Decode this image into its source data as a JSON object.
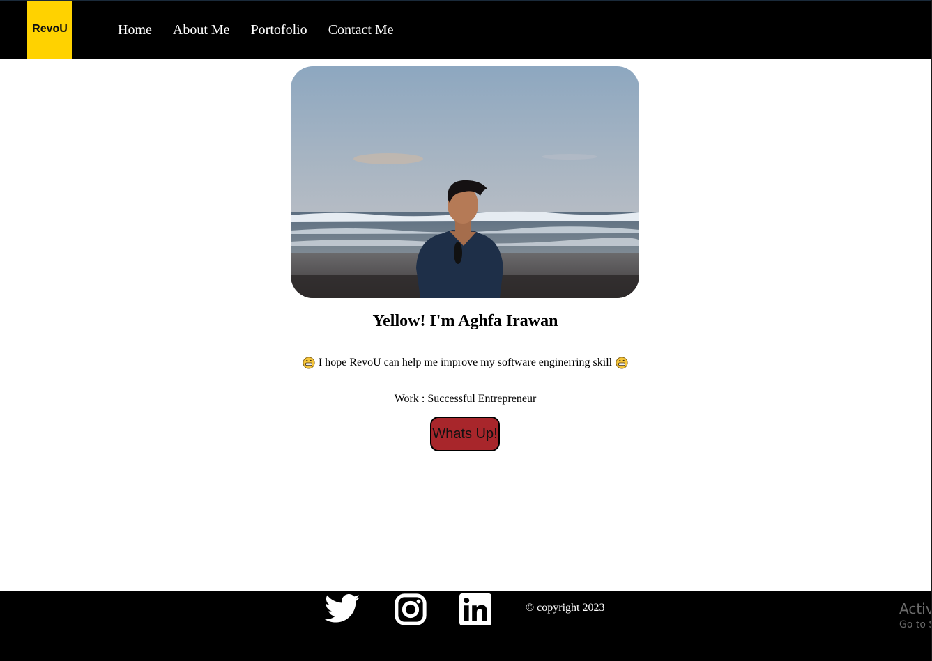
{
  "nav": {
    "logo_text": "RevoU",
    "links": [
      "Home",
      "About Me",
      "Portofolio",
      "Contact Me"
    ]
  },
  "hero": {
    "heading": "Yellow! I'm Aghfa Irawan",
    "tagline": "I hope RevoU can help me improve my software enginerring skill",
    "work": "Work : Successful Entrepreneur",
    "cta_label": "Whats Up!"
  },
  "footer": {
    "social_icons": [
      "twitter-icon",
      "instagram-icon",
      "linkedin-icon"
    ],
    "copyright": "© copyright 2023"
  },
  "os_overlay": {
    "line1": "Activ",
    "line2": "Go to S"
  },
  "colors": {
    "logo_bg": "#ffd200",
    "cta_bg": "#a8262b",
    "nav_bg": "#000000"
  }
}
